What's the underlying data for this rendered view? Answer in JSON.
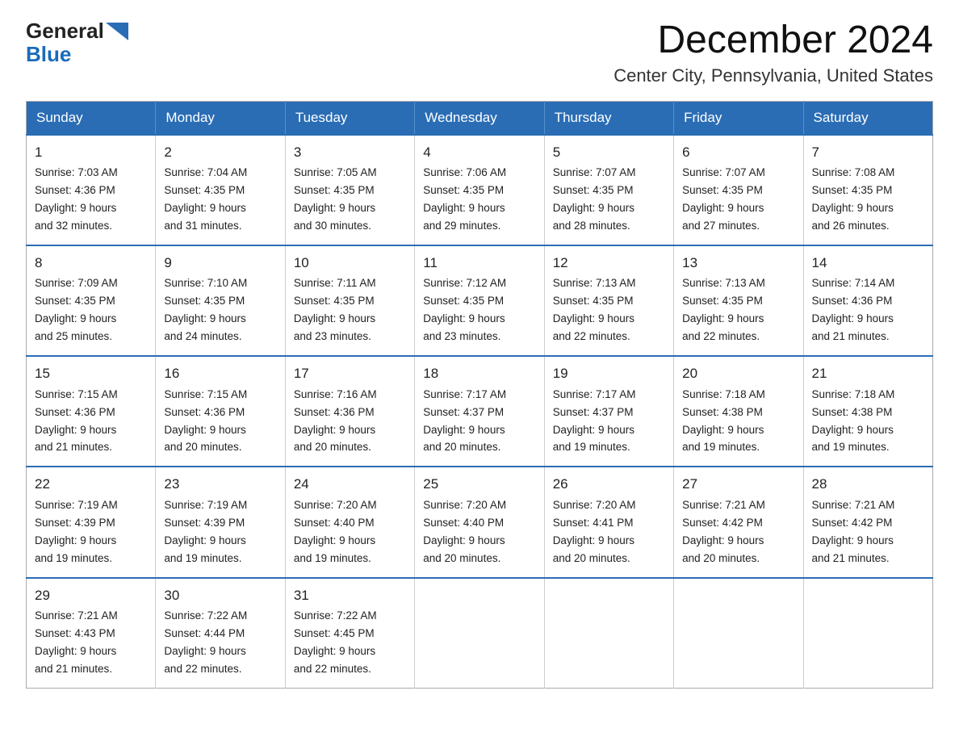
{
  "logo": {
    "general": "General",
    "triangle": "▶",
    "blue": "Blue"
  },
  "title": "December 2024",
  "subtitle": "Center City, Pennsylvania, United States",
  "days_header": [
    "Sunday",
    "Monday",
    "Tuesday",
    "Wednesday",
    "Thursday",
    "Friday",
    "Saturday"
  ],
  "weeks": [
    [
      {
        "num": "1",
        "sunrise": "7:03 AM",
        "sunset": "4:36 PM",
        "daylight": "9 hours and 32 minutes."
      },
      {
        "num": "2",
        "sunrise": "7:04 AM",
        "sunset": "4:35 PM",
        "daylight": "9 hours and 31 minutes."
      },
      {
        "num": "3",
        "sunrise": "7:05 AM",
        "sunset": "4:35 PM",
        "daylight": "9 hours and 30 minutes."
      },
      {
        "num": "4",
        "sunrise": "7:06 AM",
        "sunset": "4:35 PM",
        "daylight": "9 hours and 29 minutes."
      },
      {
        "num": "5",
        "sunrise": "7:07 AM",
        "sunset": "4:35 PM",
        "daylight": "9 hours and 28 minutes."
      },
      {
        "num": "6",
        "sunrise": "7:07 AM",
        "sunset": "4:35 PM",
        "daylight": "9 hours and 27 minutes."
      },
      {
        "num": "7",
        "sunrise": "7:08 AM",
        "sunset": "4:35 PM",
        "daylight": "9 hours and 26 minutes."
      }
    ],
    [
      {
        "num": "8",
        "sunrise": "7:09 AM",
        "sunset": "4:35 PM",
        "daylight": "9 hours and 25 minutes."
      },
      {
        "num": "9",
        "sunrise": "7:10 AM",
        "sunset": "4:35 PM",
        "daylight": "9 hours and 24 minutes."
      },
      {
        "num": "10",
        "sunrise": "7:11 AM",
        "sunset": "4:35 PM",
        "daylight": "9 hours and 23 minutes."
      },
      {
        "num": "11",
        "sunrise": "7:12 AM",
        "sunset": "4:35 PM",
        "daylight": "9 hours and 23 minutes."
      },
      {
        "num": "12",
        "sunrise": "7:13 AM",
        "sunset": "4:35 PM",
        "daylight": "9 hours and 22 minutes."
      },
      {
        "num": "13",
        "sunrise": "7:13 AM",
        "sunset": "4:35 PM",
        "daylight": "9 hours and 22 minutes."
      },
      {
        "num": "14",
        "sunrise": "7:14 AM",
        "sunset": "4:36 PM",
        "daylight": "9 hours and 21 minutes."
      }
    ],
    [
      {
        "num": "15",
        "sunrise": "7:15 AM",
        "sunset": "4:36 PM",
        "daylight": "9 hours and 21 minutes."
      },
      {
        "num": "16",
        "sunrise": "7:15 AM",
        "sunset": "4:36 PM",
        "daylight": "9 hours and 20 minutes."
      },
      {
        "num": "17",
        "sunrise": "7:16 AM",
        "sunset": "4:36 PM",
        "daylight": "9 hours and 20 minutes."
      },
      {
        "num": "18",
        "sunrise": "7:17 AM",
        "sunset": "4:37 PM",
        "daylight": "9 hours and 20 minutes."
      },
      {
        "num": "19",
        "sunrise": "7:17 AM",
        "sunset": "4:37 PM",
        "daylight": "9 hours and 19 minutes."
      },
      {
        "num": "20",
        "sunrise": "7:18 AM",
        "sunset": "4:38 PM",
        "daylight": "9 hours and 19 minutes."
      },
      {
        "num": "21",
        "sunrise": "7:18 AM",
        "sunset": "4:38 PM",
        "daylight": "9 hours and 19 minutes."
      }
    ],
    [
      {
        "num": "22",
        "sunrise": "7:19 AM",
        "sunset": "4:39 PM",
        "daylight": "9 hours and 19 minutes."
      },
      {
        "num": "23",
        "sunrise": "7:19 AM",
        "sunset": "4:39 PM",
        "daylight": "9 hours and 19 minutes."
      },
      {
        "num": "24",
        "sunrise": "7:20 AM",
        "sunset": "4:40 PM",
        "daylight": "9 hours and 19 minutes."
      },
      {
        "num": "25",
        "sunrise": "7:20 AM",
        "sunset": "4:40 PM",
        "daylight": "9 hours and 20 minutes."
      },
      {
        "num": "26",
        "sunrise": "7:20 AM",
        "sunset": "4:41 PM",
        "daylight": "9 hours and 20 minutes."
      },
      {
        "num": "27",
        "sunrise": "7:21 AM",
        "sunset": "4:42 PM",
        "daylight": "9 hours and 20 minutes."
      },
      {
        "num": "28",
        "sunrise": "7:21 AM",
        "sunset": "4:42 PM",
        "daylight": "9 hours and 21 minutes."
      }
    ],
    [
      {
        "num": "29",
        "sunrise": "7:21 AM",
        "sunset": "4:43 PM",
        "daylight": "9 hours and 21 minutes."
      },
      {
        "num": "30",
        "sunrise": "7:22 AM",
        "sunset": "4:44 PM",
        "daylight": "9 hours and 22 minutes."
      },
      {
        "num": "31",
        "sunrise": "7:22 AM",
        "sunset": "4:45 PM",
        "daylight": "9 hours and 22 minutes."
      },
      null,
      null,
      null,
      null
    ]
  ],
  "sunrise_label": "Sunrise:",
  "sunset_label": "Sunset:",
  "daylight_label": "Daylight:"
}
